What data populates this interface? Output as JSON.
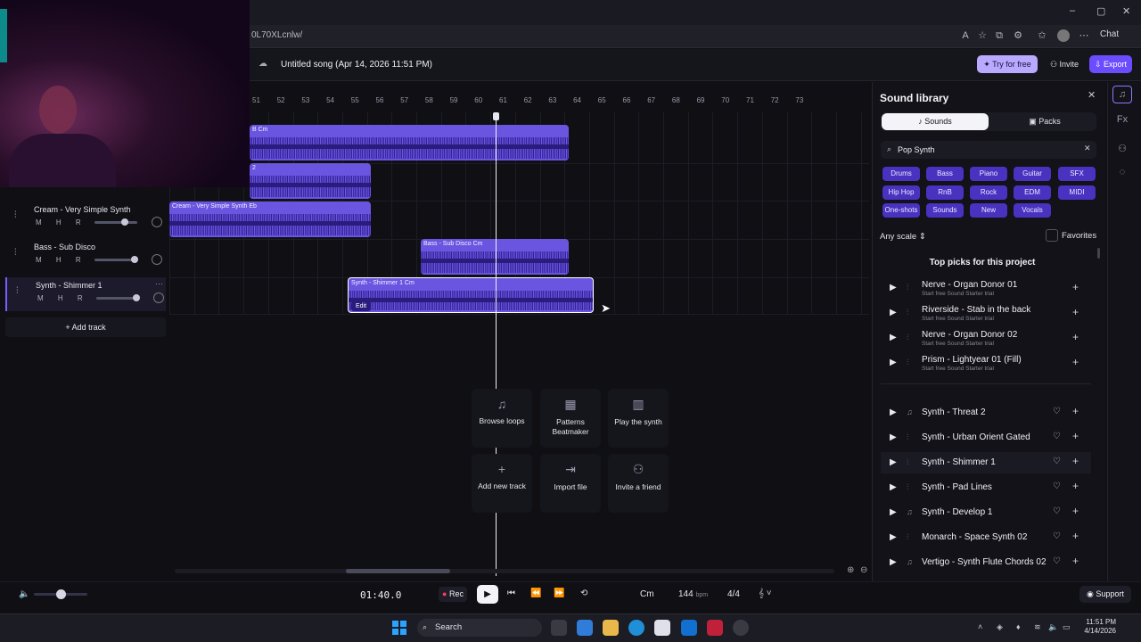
{
  "browser": {
    "url": "0L70XLcnlw/",
    "chat_label": "Chat"
  },
  "header": {
    "song_title": "Untitled song (Apr 14, 2026 11:51 PM)",
    "try_label": "Try for free",
    "invite_label": "Invite",
    "export_label": "Export"
  },
  "ruler": [
    "51",
    "52",
    "53",
    "54",
    "55",
    "56",
    "57",
    "58",
    "59",
    "60",
    "61",
    "62",
    "63",
    "64",
    "65",
    "66",
    "67",
    "68",
    "69",
    "70",
    "71",
    "72",
    "73"
  ],
  "tracks": [
    {
      "name": "Cream - Very Simple Synth",
      "controls": "M H R"
    },
    {
      "name": "Bass - Sub Disco",
      "controls": "M H R"
    },
    {
      "name": "Synth - Shimmer 1",
      "controls": "M H R"
    }
  ],
  "add_track_label": "Add track",
  "clips": {
    "c1": "B Cm",
    "c2": "2",
    "c3": "Cream - Very Simple Synth Eb",
    "c4": "Bass - Sub Disco Cm",
    "c5": "Synth - Shimmer 1 Cm",
    "edit": "Edit"
  },
  "quick_actions": {
    "browse": "Browse loops",
    "patterns": "Patterns Beatmaker",
    "play": "Play the synth",
    "add": "Add new track",
    "import": "Import file",
    "invite": "Invite a friend"
  },
  "transport": {
    "time": "01:40.0",
    "rec_label": "Rec",
    "key": "Cm",
    "bpm": "144",
    "bpm_unit": "bpm",
    "signature": "4/4",
    "support_label": "Support",
    "volume": 0.5
  },
  "library": {
    "title": "Sound library",
    "tab_sounds": "Sounds",
    "tab_packs": "Packs",
    "search_value": "Pop Synth",
    "tags": [
      "Drums",
      "Bass",
      "Piano",
      "Guitar",
      "SFX",
      "Hip Hop",
      "RnB",
      "Rock",
      "EDM",
      "MIDI",
      "One-shots",
      "Sounds",
      "New",
      "Vocals"
    ],
    "any_scale": "Any scale",
    "favorites": "Favorites",
    "top_picks_title": "Top picks for this project",
    "top_picks": [
      {
        "name": "Nerve - Organ Donor 01",
        "sub": "Start free Sound Starter trial"
      },
      {
        "name": "Riverside - Stab in the back",
        "sub": "Start free Sound Starter trial"
      },
      {
        "name": "Nerve - Organ Donor 02",
        "sub": "Start free Sound Starter trial"
      },
      {
        "name": "Prism - Lightyear 01 (Fill)",
        "sub": "Start free Sound Starter trial"
      }
    ],
    "sounds": [
      "Synth - Threat 2",
      "Synth - Urban Orient Gated",
      "Synth - Shimmer 1",
      "Synth - Pad Lines",
      "Synth - Develop 1",
      "Monarch - Space Synth 02",
      "Vertigo - Synth Flute Chords 02"
    ]
  },
  "taskbar": {
    "search_label": "Search",
    "time": "11:51 PM",
    "date": "4/14/2026"
  },
  "colors": {
    "accent": "#6b4dff",
    "clip": "#6a55e0",
    "tag": "#4a32c0"
  }
}
